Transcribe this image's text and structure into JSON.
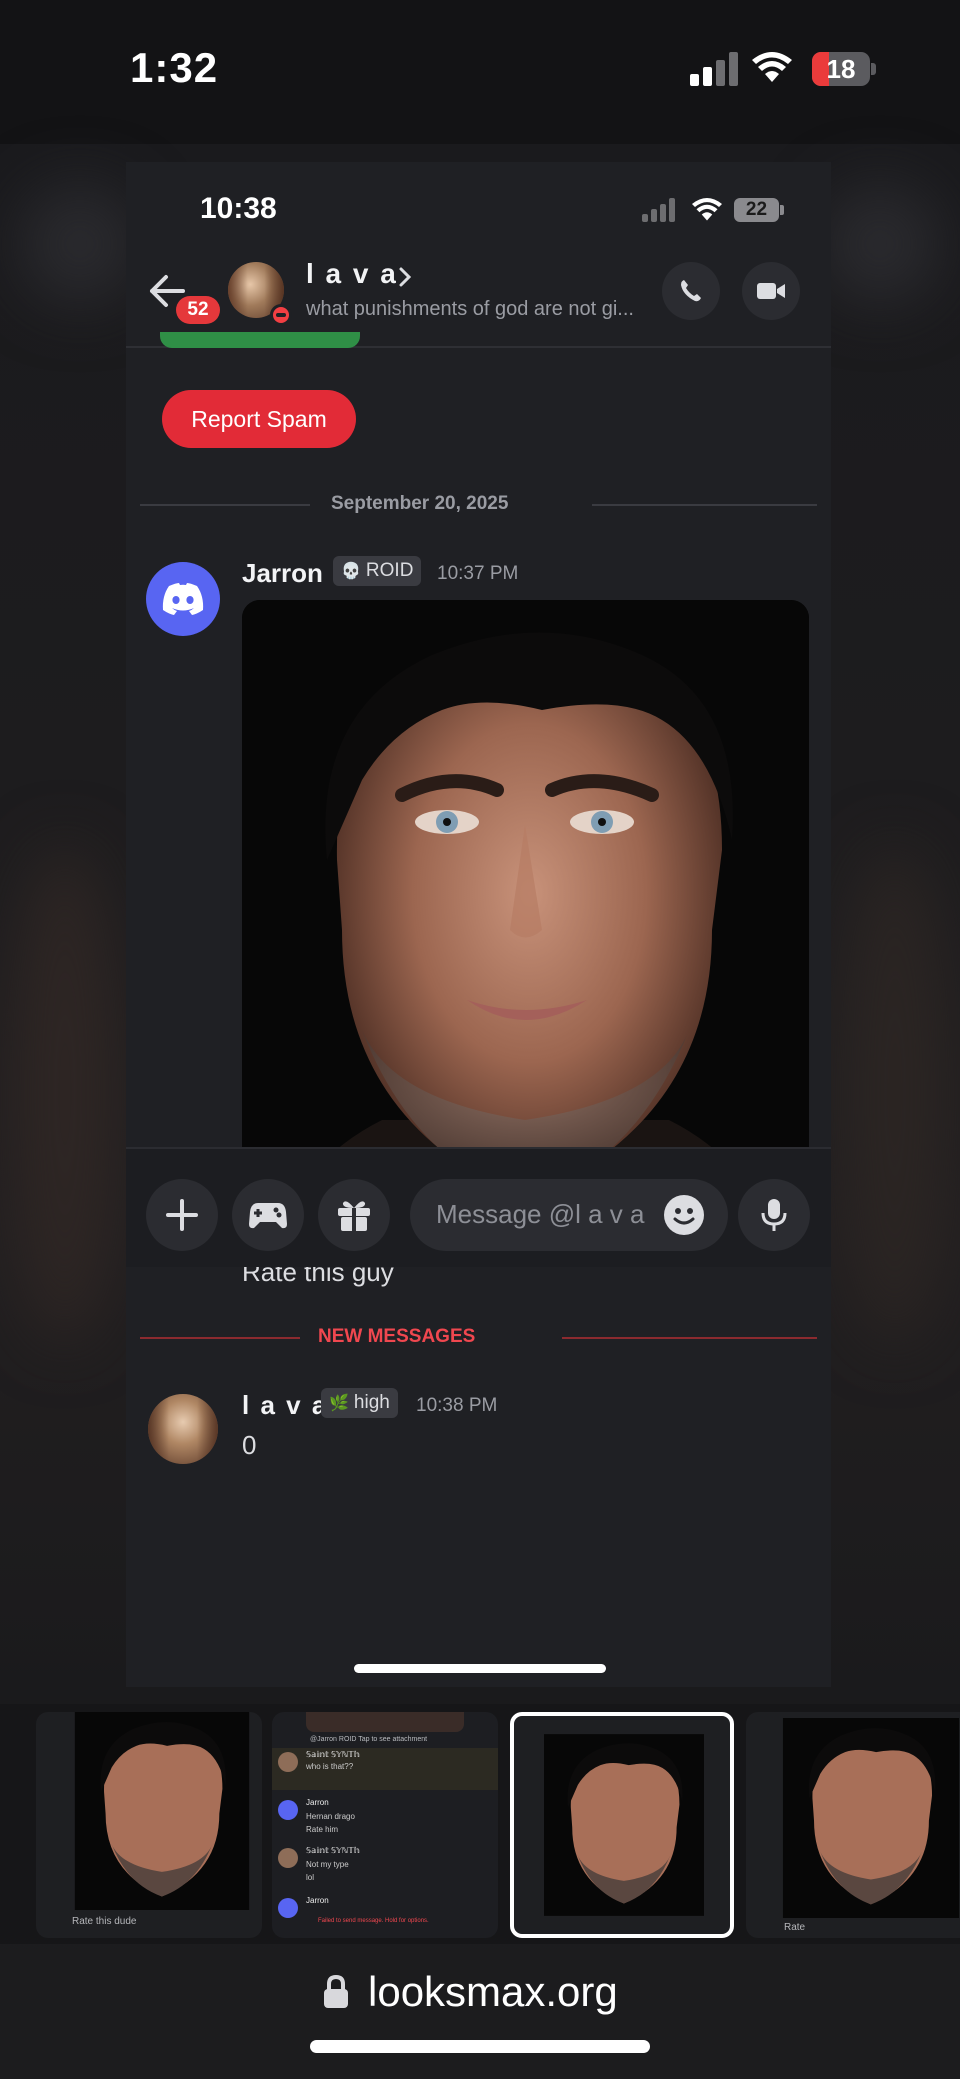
{
  "outer_status": {
    "time": "1:32",
    "battery": "18"
  },
  "chat": {
    "status_time": "10:38",
    "status_battery": "22",
    "back_badge": "52",
    "contact_name": "l a v a",
    "contact_status": "what punishments of god are not gi...",
    "report_label": "Report Spam",
    "date_divider": "September 20, 2025",
    "messages": [
      {
        "author": "Jarron",
        "tag_emoji": "💀",
        "tag": "ROID",
        "time": "10:37 PM",
        "text": "Rate this guy"
      },
      {
        "author": "l a v a",
        "tag_emoji": "🌿",
        "tag": "high",
        "time": "10:38 PM",
        "text": "0"
      }
    ],
    "new_messages_label": "NEW MESSAGES",
    "composer_placeholder": "Message @l a v a"
  },
  "thumbnails": [
    {
      "caption": "Rate this dude"
    },
    {
      "header": "@Jarron  ROID  Tap to see attachment",
      "rows": [
        {
          "author": "𝕊𝕒𝕚𝕟𝕥 𝕊𝕐ℕ𝕋𝕙",
          "tag": "STAR",
          "time": "10:43 PM",
          "text": "who is that??"
        },
        {
          "author": "Jarron",
          "tag": "ROID",
          "time": "10:43 PM",
          "text": "Hernan drago\nRate him"
        },
        {
          "author": "𝕊𝕒𝕚𝕟𝕥 𝕊𝕐ℕ𝕋𝕙",
          "tag": "STAR",
          "time": "10:44 PM",
          "text": "Not my type\nlol"
        },
        {
          "author": "Jarron",
          "tag": "ROID",
          "time": "10:41 PM",
          "text": ""
        }
      ],
      "error": "Failed to send message. Hold for options."
    },
    {
      "caption": ""
    },
    {
      "caption": "Rate"
    }
  ],
  "url_bar": {
    "domain": "looksmax.org"
  },
  "colors": {
    "accent_red": "#e22b37",
    "discord_blurple": "#5865f2",
    "background": "#1f2024"
  }
}
